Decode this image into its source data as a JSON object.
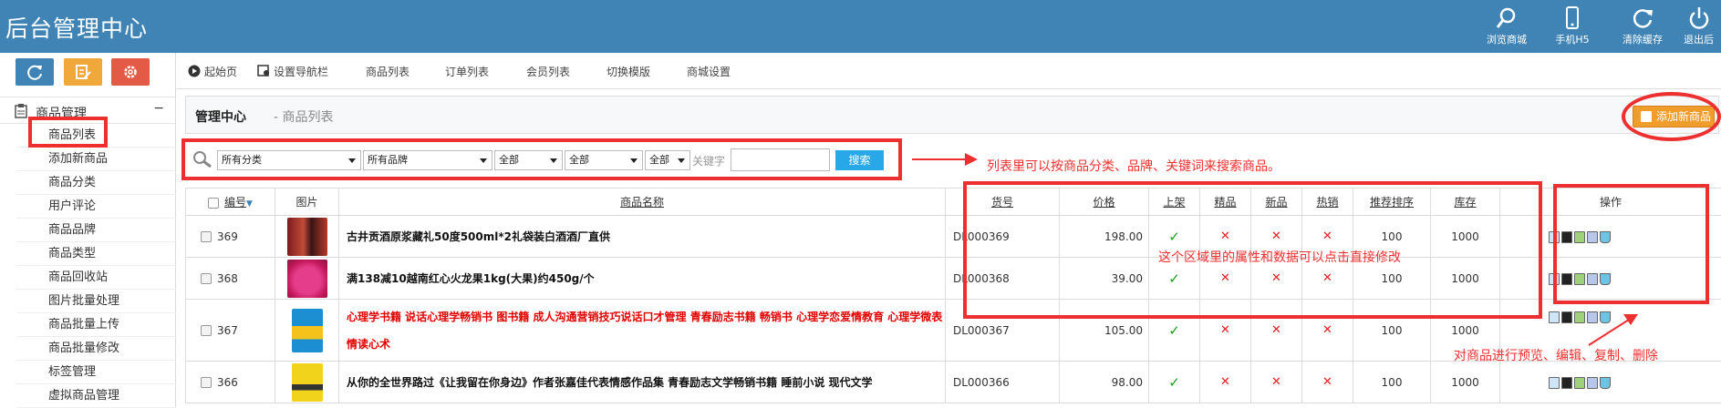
{
  "header": {
    "title": "后台管理中心",
    "buttons": [
      {
        "label": "浏览商城",
        "icon": "search-icon"
      },
      {
        "label": "手机H5",
        "icon": "mobile-icon"
      },
      {
        "label": "清除缓存",
        "icon": "refresh-icon"
      },
      {
        "label": "退出后",
        "icon": "power-icon"
      }
    ]
  },
  "quick_buttons": [
    {
      "icon": "refresh-icon",
      "color": "#3f84b5"
    },
    {
      "icon": "edit-icon",
      "color": "#f1a83b"
    },
    {
      "icon": "gear-icon",
      "color": "#e35a47"
    }
  ],
  "sidebar": {
    "section": "商品管理",
    "collapse": "−",
    "items": [
      "商品列表",
      "添加新商品",
      "商品分类",
      "用户评论",
      "商品品牌",
      "商品类型",
      "商品回收站",
      "图片批量处理",
      "商品批量上传",
      "商品批量修改",
      "标签管理",
      "虚拟商品管理"
    ]
  },
  "toolbar": {
    "items": [
      "起始页",
      "设置导航栏",
      "商品列表",
      "订单列表",
      "会员列表",
      "切换模版",
      "商城设置"
    ]
  },
  "breadcrumb": {
    "title": "管理中心",
    "sub": "- 商品列表"
  },
  "add_button": "添加新商品",
  "search": {
    "category": "所有分类",
    "brand": "所有品牌",
    "filter1": "全部",
    "filter2": "全部",
    "filter3": "全部",
    "keyword_label": "关键字",
    "keyword_value": "",
    "button": "搜索"
  },
  "table": {
    "headers": [
      "编号",
      "图片",
      "商品名称",
      "货号",
      "价格",
      "上架",
      "精品",
      "新品",
      "热销",
      "推荐排序",
      "库存",
      "操作"
    ],
    "rows": [
      {
        "id": "369",
        "name": "古井贡酒原浆藏礼50度500ml*2礼袋装白酒酒厂直供",
        "sku": "DL000369",
        "price": "198.00",
        "on_sale": "✓",
        "best": "✕",
        "new": "✕",
        "hot": "✕",
        "sort": "100",
        "stock": "1000",
        "red": false
      },
      {
        "id": "368",
        "name": "满138减10越南红心火龙果1kg(大果)约450g/个",
        "sku": "DL000368",
        "price": "39.00",
        "on_sale": "✓",
        "best": "✕",
        "new": "✕",
        "hot": "✕",
        "sort": "100",
        "stock": "1000",
        "red": false
      },
      {
        "id": "367",
        "name": "心理学书籍 说话心理学畅销书 图书籍 成人沟通营销技巧说话口才管理 青春励志书籍 畅销书 心理学恋爱情教育 心理学微表情读心术",
        "sku": "DL000367",
        "price": "105.00",
        "on_sale": "✓",
        "best": "✕",
        "new": "✕",
        "hot": "✕",
        "sort": "100",
        "stock": "1000",
        "red": true
      },
      {
        "id": "366",
        "name": "从你的全世界路过《让我留在你身边》作者张嘉佳代表情感作品集 青春励志文学畅销书籍 睡前小说 现代文学",
        "sku": "DL000366",
        "price": "98.00",
        "on_sale": "✓",
        "best": "✕",
        "new": "✕",
        "hot": "✕",
        "sort": "100",
        "stock": "1000",
        "red": false
      }
    ]
  },
  "annotations": {
    "search_note": "列表里可以按商品分类、品牌、关键词来搜索商品。",
    "edit_note": "这个区域里的属性和数据可以点击直接修改",
    "ops_note": "对商品进行预览、编辑、复制、删除"
  },
  "colors": {
    "header": "#3f84b5",
    "annotation": "#ee2f2f",
    "accent": "#f09c2b",
    "search_button": "#29a8e8"
  }
}
